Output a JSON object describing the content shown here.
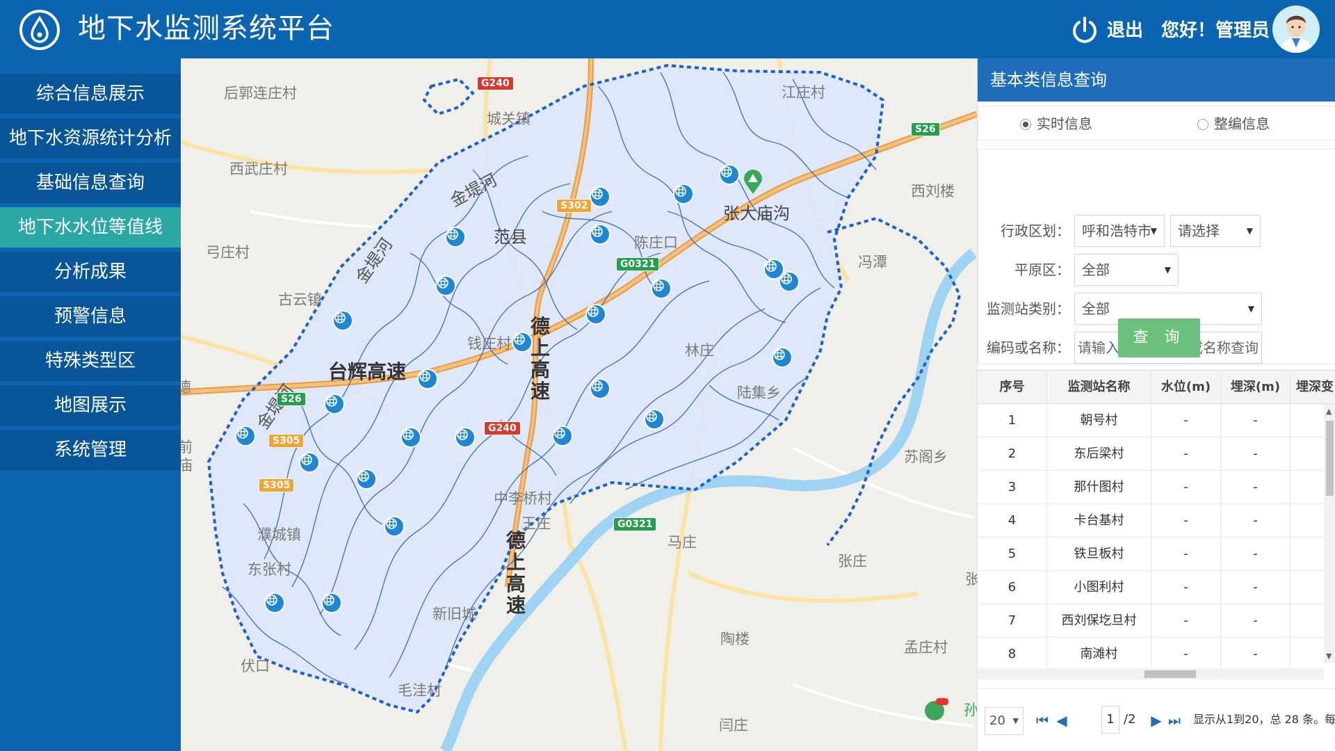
{
  "header": {
    "title": "地下水监测系统平台",
    "logout": "退出",
    "greeting": "您好！管理员"
  },
  "sidebar": {
    "items": [
      {
        "label": "综合信息展示",
        "active": false
      },
      {
        "label": "地下水资源统计分析",
        "active": false
      },
      {
        "label": "基础信息查询",
        "active": false
      },
      {
        "label": "地下水水位等值线",
        "active": true
      },
      {
        "label": "分析成果",
        "active": false
      },
      {
        "label": "预警信息",
        "active": false
      },
      {
        "label": "特殊类型区",
        "active": false
      },
      {
        "label": "地图展示",
        "active": false
      },
      {
        "label": "系统管理",
        "active": false
      }
    ]
  },
  "map": {
    "places": [
      "后郭连庄村",
      "城关镇",
      "西武庄村",
      "弓庄村",
      "古云镇",
      "范县",
      "陈庄口",
      "钱庄村",
      "林庄",
      "陆集乡",
      "中李桥村",
      "王庄",
      "马庄",
      "张庄",
      "濮城镇",
      "东张村",
      "新旧城",
      "陶楼",
      "孟庄村",
      "伏口",
      "毛洼村",
      "闫庄",
      "江庄村",
      "张大庙沟",
      "西刘楼",
      "冯潭",
      "苏阁乡"
    ],
    "roads": {
      "taihui": "台辉高速",
      "deshang1": "德上高速",
      "deshang2": "德上高速"
    },
    "rivers": {
      "jindi1": "金堤河",
      "jindi2": "金堤河",
      "jindi3": "金堤河"
    },
    "shields": [
      "G240",
      "S302",
      "G0321",
      "S26",
      "S26",
      "S305",
      "S305",
      "G240",
      "G0321"
    ],
    "partial_labels": [
      "德",
      "前庙",
      "张",
      "孙"
    ]
  },
  "panel": {
    "title": "基本类信息查询",
    "radios": [
      {
        "label": "实时信息",
        "checked": true
      },
      {
        "label": "整编信息",
        "checked": false
      }
    ],
    "form": {
      "region_label": "行政区划：",
      "region_value": "呼和浩特市",
      "region_sub_value": "请选择",
      "plain_label": "平原区：",
      "plain_value": "全部",
      "category_label": "监测站类别：",
      "category_value": "全部",
      "code_label": "编码或名称：",
      "code_placeholder": "请输入监测站编码或名称查询",
      "query_button": "查 询"
    },
    "table": {
      "columns": [
        "序号",
        "监测站名称",
        "水位(m)",
        "埋深(m)",
        "埋深变"
      ],
      "rows": [
        [
          "1",
          "朝号村",
          "-",
          "-"
        ],
        [
          "2",
          "东后梁村",
          "-",
          "-"
        ],
        [
          "3",
          "那什图村",
          "-",
          "-"
        ],
        [
          "4",
          "卡台基村",
          "-",
          "-"
        ],
        [
          "5",
          "铁旦板村",
          "-",
          "-"
        ],
        [
          "6",
          "小图利村",
          "-",
          "-"
        ],
        [
          "7",
          "西刘保圪旦村",
          "-",
          "-"
        ],
        [
          "8",
          "南滩村",
          "-",
          "-"
        ]
      ]
    },
    "pager": {
      "page_size": "20",
      "current_page": "1",
      "total_pages": "/2",
      "summary": "显示从1到20，总 28 条。每"
    }
  },
  "colors": {
    "header_bg": "#0b64b0",
    "sidebar_item_bg": "#09559a",
    "active_item_bg": "#2ba7a5",
    "panel_title_bg": "#1f6dbb",
    "query_button_bg": "#6cbf7d",
    "station_marker": "#1e86d4",
    "area_fill": "#dce7f8",
    "boundary": "#1a5fd6"
  }
}
